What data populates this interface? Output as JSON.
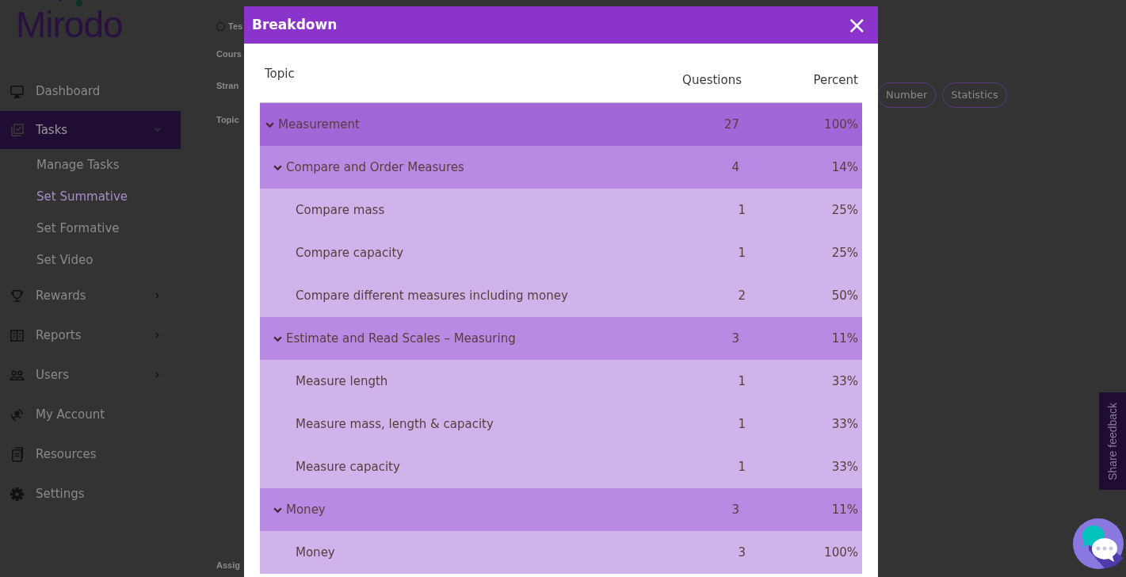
{
  "logo": {
    "text": "Mirodo"
  },
  "sidebar": {
    "items": [
      {
        "label": "Dashboard",
        "active": false
      },
      {
        "label": "Tasks",
        "active": true,
        "expanded": true,
        "children": [
          {
            "label": "Manage Tasks",
            "selected": false
          },
          {
            "label": "Set Summative",
            "selected": true
          },
          {
            "label": "Set Formative",
            "selected": false
          },
          {
            "label": "Set Video",
            "selected": false
          }
        ]
      },
      {
        "label": "Rewards",
        "active": false,
        "expanded": false
      },
      {
        "label": "Reports",
        "active": false,
        "expanded": false
      },
      {
        "label": "Users",
        "active": false,
        "expanded": false
      },
      {
        "label": "My Account",
        "active": false
      },
      {
        "label": "Resources",
        "active": false
      },
      {
        "label": "Settings",
        "active": false
      }
    ]
  },
  "form": {
    "radio_label": "Tes",
    "radio_checked": false,
    "labels": [
      "Cours",
      "Stran",
      "Topic"
    ],
    "chips": [
      "Number",
      "Statistics"
    ],
    "footer_label": "Assig"
  },
  "modal": {
    "title": "Breakdown",
    "close": "×",
    "columns": [
      "Topic",
      "Questions",
      "Percent"
    ],
    "rows": [
      {
        "topic": "Measurement",
        "questions": "27",
        "percent": "100%",
        "expanded": true,
        "children": [
          {
            "topic": "Compare and Order Measures",
            "questions": "4",
            "percent": "14%",
            "expanded": true,
            "children": [
              {
                "topic": "Compare mass",
                "questions": "1",
                "percent": "25%"
              },
              {
                "topic": "Compare capacity",
                "questions": "1",
                "percent": "25%"
              },
              {
                "topic": "Compare different measures including money",
                "questions": "2",
                "percent": "50%"
              }
            ]
          },
          {
            "topic": "Estimate and Read Scales – Measuring",
            "questions": "3",
            "percent": "11%",
            "expanded": true,
            "children": [
              {
                "topic": "Measure length",
                "questions": "1",
                "percent": "33%"
              },
              {
                "topic": "Measure mass, length & capacity",
                "questions": "1",
                "percent": "33%"
              },
              {
                "topic": "Measure capacity",
                "questions": "1",
                "percent": "33%"
              }
            ]
          },
          {
            "topic": "Money",
            "questions": "3",
            "percent": "11%",
            "expanded": true,
            "children": [
              {
                "topic": "Money",
                "questions": "3",
                "percent": "100%"
              }
            ]
          }
        ]
      }
    ]
  },
  "feedback_tab": {
    "label": "Share feedback"
  }
}
